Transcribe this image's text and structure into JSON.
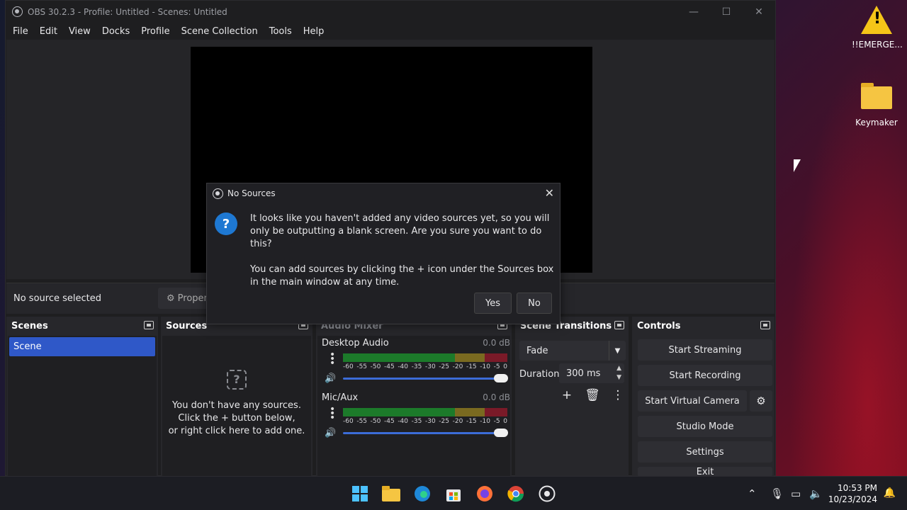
{
  "window": {
    "title": "OBS 30.2.3 - Profile: Untitled - Scenes: Untitled",
    "minimize_icon": "—",
    "maximize_icon": "☐",
    "close_icon": "✕"
  },
  "menu": [
    "File",
    "Edit",
    "View",
    "Docks",
    "Profile",
    "Scene Collection",
    "Tools",
    "Help"
  ],
  "source_bar": {
    "status": "No source selected",
    "properties_label": "Proper"
  },
  "docks": {
    "scenes": {
      "title": "Scenes",
      "items": [
        "Scene"
      ]
    },
    "sources": {
      "title": "Sources",
      "empty_line1": "You don't have any sources.",
      "empty_line2": "Click the + button below,",
      "empty_line3": "or right click here to add one."
    },
    "audio_mixer": {
      "title": "Audio Mixer",
      "channels": [
        {
          "name": "Desktop Audio",
          "db": "0.0 dB",
          "volume_fraction": 1.0
        },
        {
          "name": "Mic/Aux",
          "db": "0.0 dB",
          "volume_fraction": 1.0
        }
      ],
      "ticks": [
        "-60",
        "-55",
        "-50",
        "-45",
        "-40",
        "-35",
        "-30",
        "-25",
        "-20",
        "-15",
        "-10",
        "-5",
        "0"
      ]
    },
    "transitions": {
      "title": "Scene Transitions",
      "selected": "Fade",
      "duration_label": "Duration",
      "duration_value": "300 ms"
    },
    "controls": {
      "title": "Controls",
      "buttons": [
        "Start Streaming",
        "Start Recording",
        "Start Virtual Camera",
        "Studio Mode",
        "Settings",
        "Exit"
      ]
    }
  },
  "dialog": {
    "title": "No Sources",
    "message1": "It looks like you haven't added any video sources yet, so you will only be outputting a blank screen. Are you sure you want to do this?",
    "message2": "You can add sources by clicking the + icon under the Sources box in the main window at any time.",
    "yes": "Yes",
    "no": "No"
  },
  "desktop": {
    "icons": [
      {
        "label": "!!EMERGE...",
        "icon": "warning-icon"
      },
      {
        "label": "Keymaker",
        "icon": "folder-icon"
      }
    ]
  },
  "taskbar": {
    "time": "10:53 PM",
    "date": "10/23/2024"
  },
  "colors": {
    "accent": "#2f58c8",
    "meter_green": "#1c7a2a",
    "meter_yellow": "#7a6a20",
    "meter_red": "#7a1a28",
    "dialog_icon": "#1e78d2"
  }
}
